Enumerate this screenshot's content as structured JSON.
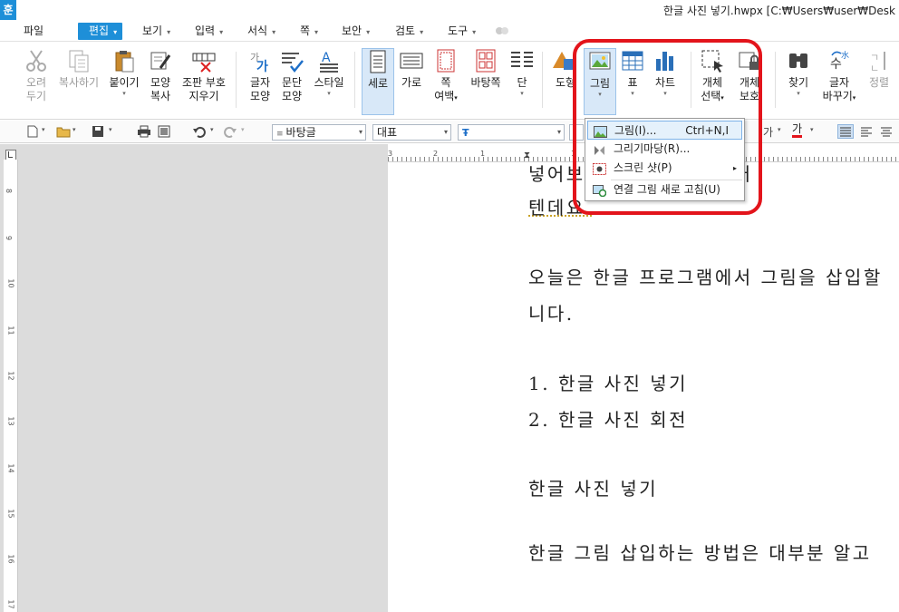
{
  "app": {
    "logo": "훈",
    "title": "한글 사진 넣기.hwpx [C:₩Users₩user₩Desk"
  },
  "menu": [
    {
      "label": "파일",
      "arrow": false
    },
    {
      "label": "편집",
      "arrow": true,
      "active": true
    },
    {
      "label": "보기",
      "arrow": true
    },
    {
      "label": "입력",
      "arrow": true
    },
    {
      "label": "서식",
      "arrow": true
    },
    {
      "label": "쪽",
      "arrow": true
    },
    {
      "label": "보안",
      "arrow": true
    },
    {
      "label": "검토",
      "arrow": true
    },
    {
      "label": "도구",
      "arrow": true
    }
  ],
  "ribbon": {
    "cut": [
      "오려",
      "두기"
    ],
    "copy": "복사하기",
    "paste": "붙이기",
    "format_copy": [
      "모양",
      "복사"
    ],
    "clear_marks": [
      "조판 부호",
      "지우기"
    ],
    "char_shape": [
      "글자",
      "모양"
    ],
    "para_shape": [
      "문단",
      "모양"
    ],
    "style": "스타일",
    "portrait": "세로",
    "landscape": "가로",
    "margin": [
      "쪽",
      "여백"
    ],
    "background": "바탕쪽",
    "columns": "단",
    "shapes": "도형",
    "picture": "그림",
    "table": "표",
    "chart": "차트",
    "select_object": [
      "개체",
      "선택"
    ],
    "protect_object": [
      "개체",
      "보호"
    ],
    "find": "찾기",
    "replace": [
      "글자",
      "바꾸기"
    ],
    "align": "정렬"
  },
  "toolbar2": {
    "style_combo": "바탕글",
    "font_lang_combo": "대표",
    "font_combo": "",
    "char_a": "가",
    "char_b": "가"
  },
  "ruler": {
    "h_numbers": [
      "3",
      "2",
      "1",
      "1",
      "2"
    ],
    "v_numbers": [
      "8",
      "9",
      "10",
      "11",
      "12",
      "13",
      "14",
      "15",
      "16",
      "17"
    ]
  },
  "document": {
    "lines": [
      "넣어보기                   사진이  넘어졌거",
      "텐데요.",
      "오늘은  한글  프로그램에서  그림을  삽입할",
      "니다.",
      "1. 한글  사진  넣기",
      "2. 한글  사진  회전",
      "한글  사진  넣기",
      "한글  그림  삽입하는  방법은  대부분  알고"
    ]
  },
  "dropdown": {
    "items": [
      {
        "label": "그림(I)...",
        "shortcut": "Ctrl+N,I",
        "icon": "picture-icon"
      },
      {
        "label": "그리기마당(R)...",
        "shortcut": "",
        "icon": "clipart-icon"
      },
      {
        "label": "스크린 샷(P)",
        "shortcut": "",
        "submenu": true,
        "icon": "screenshot-icon"
      },
      {
        "label": "연결 그림 새로 고침(U)",
        "shortcut": "",
        "icon": "refresh-picture-icon"
      }
    ]
  },
  "colors": {
    "accent": "#1e8fd8",
    "annotation": "#e3141b"
  }
}
